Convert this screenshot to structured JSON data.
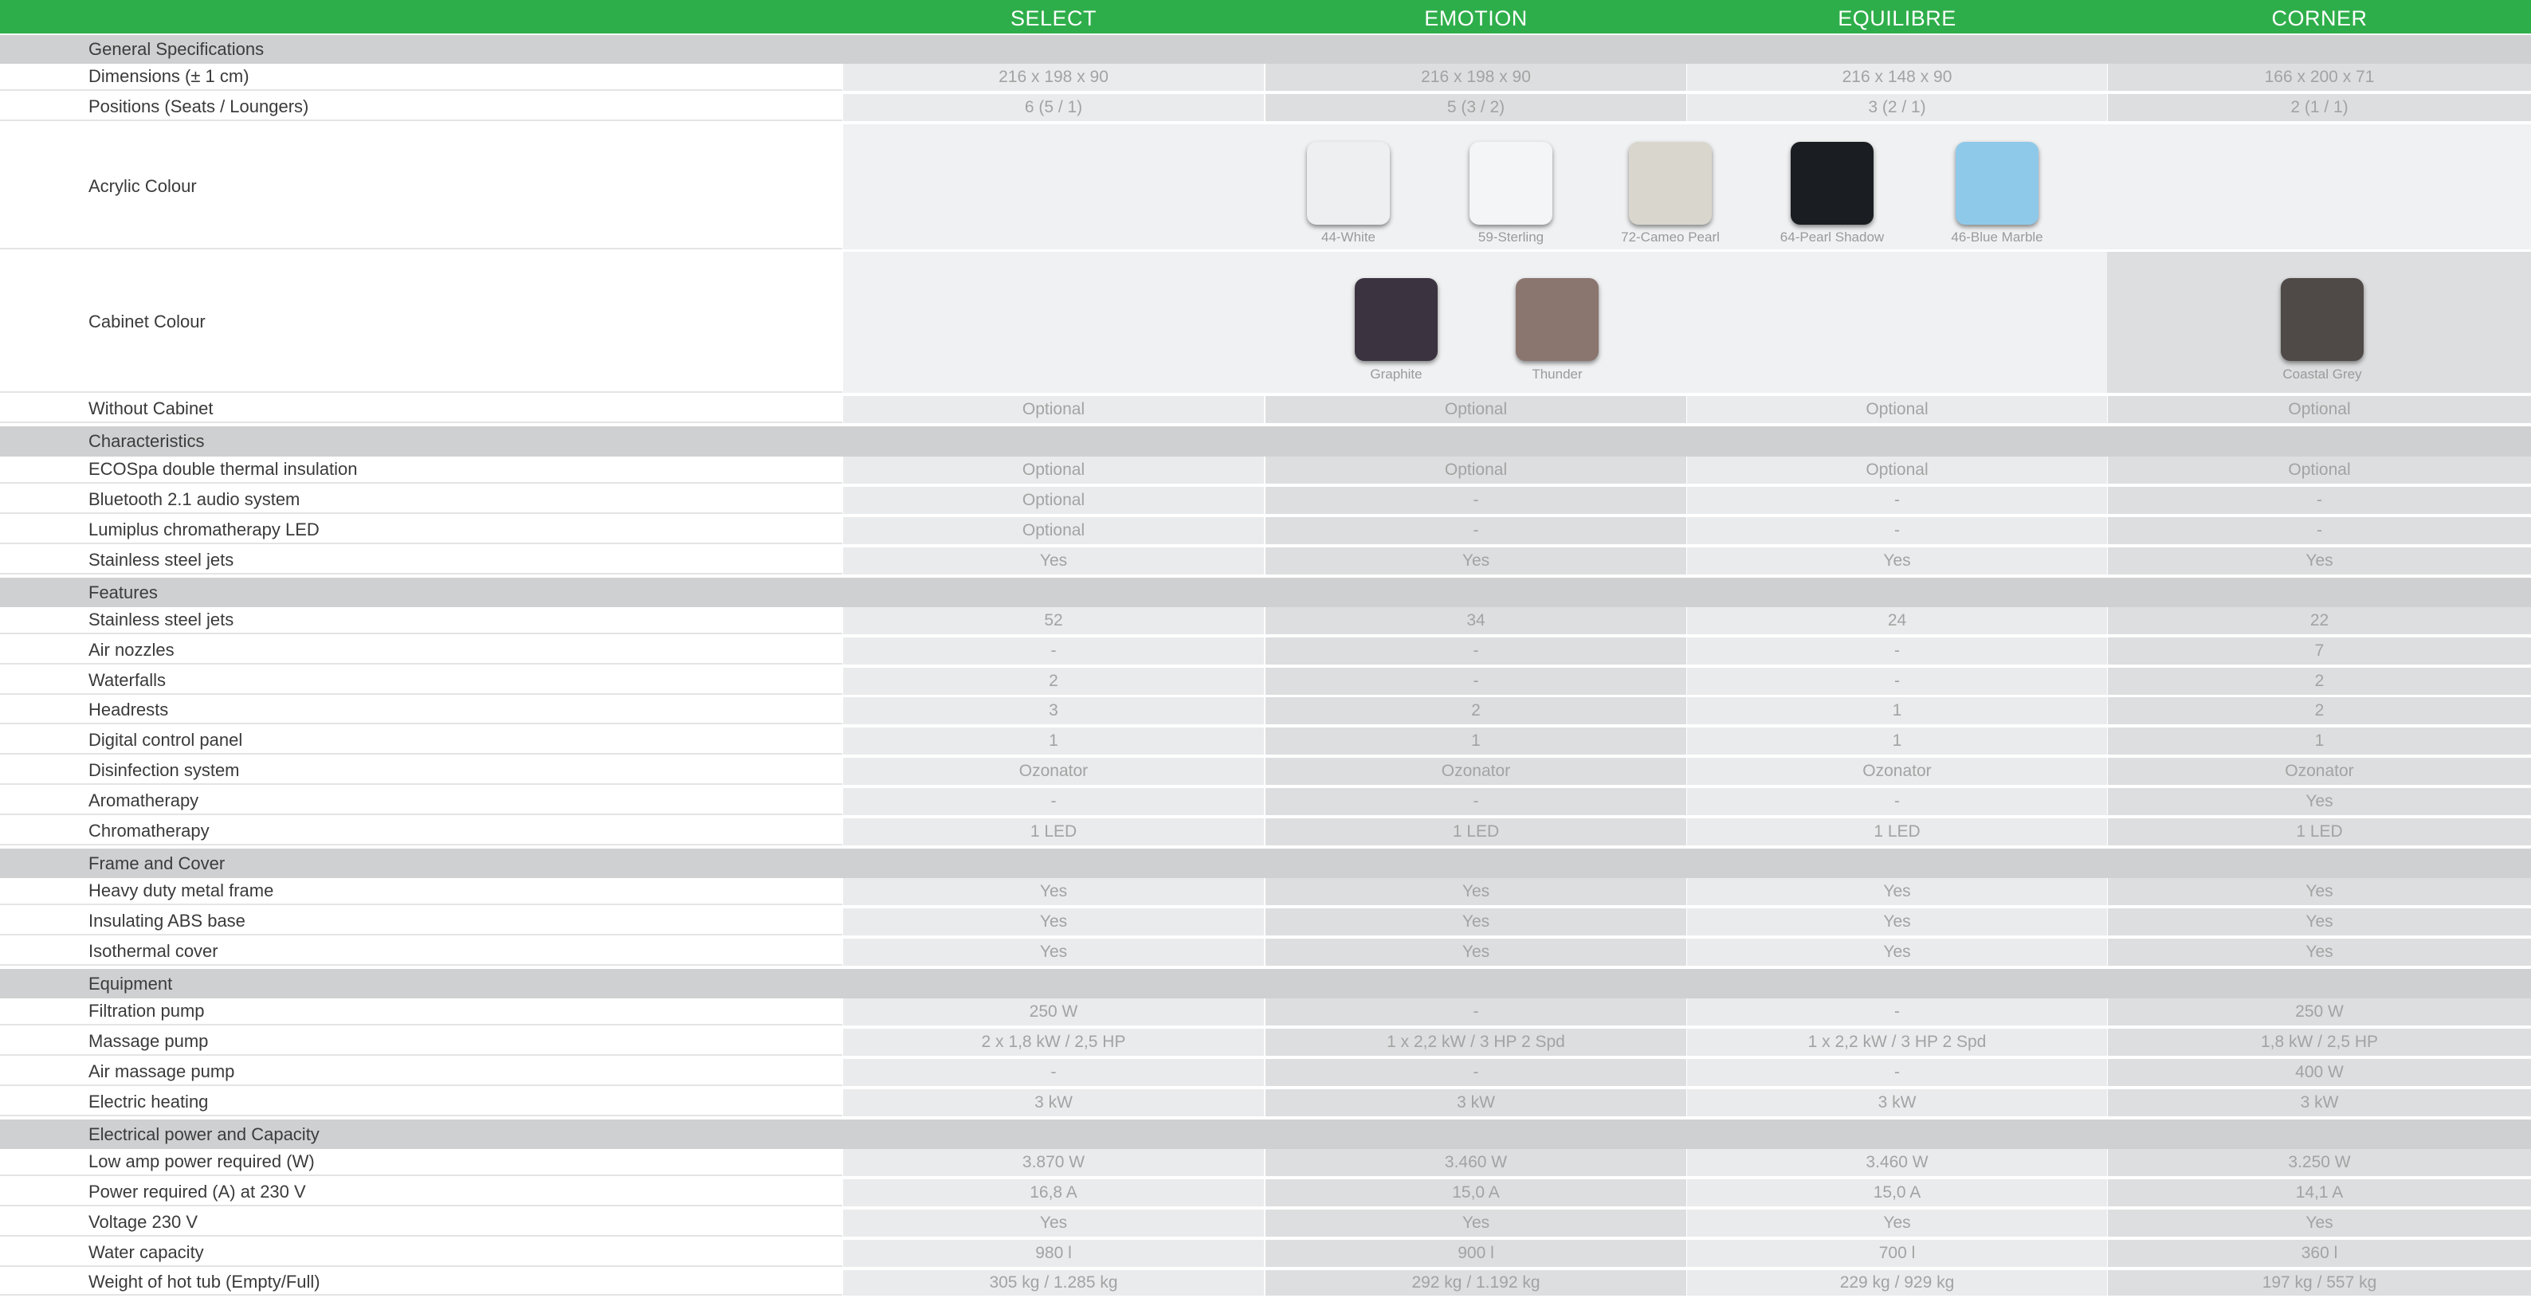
{
  "columns": [
    "SELECT",
    "EMOTION",
    "EQUILIBRE",
    "CORNER"
  ],
  "sections": {
    "general": "General Specifications",
    "characteristics": "Characteristics",
    "features": "Features",
    "frame": "Frame and Cover",
    "equipment": "Equipment",
    "electrical": "Electrical power and Capacity"
  },
  "rows": {
    "dimensions": {
      "label": "Dimensions (± 1 cm)",
      "values": [
        "216 x 198 x 90",
        "216 x 198 x 90",
        "216 x 148 x 90",
        "166 x 200 x 71"
      ]
    },
    "positions": {
      "label": "Positions (Seats / Loungers)",
      "values": [
        "6 (5 / 1)",
        "5 (3 / 2)",
        "3 (2 / 1)",
        "2 (1 / 1)"
      ]
    },
    "acrylic": {
      "label": "Acrylic Colour"
    },
    "cabinet": {
      "label": "Cabinet Colour"
    },
    "without_cabinet": {
      "label": "Without Cabinet",
      "values": [
        "Optional",
        "Optional",
        "Optional",
        "Optional"
      ]
    },
    "ecospa": {
      "label": "ECOSpa double thermal insulation",
      "values": [
        "Optional",
        "Optional",
        "Optional",
        "Optional"
      ]
    },
    "bluetooth": {
      "label": "Bluetooth 2.1 audio system",
      "values": [
        "Optional",
        "-",
        "-",
        "-"
      ]
    },
    "lumiplus": {
      "label": "Lumiplus chromatherapy LED",
      "values": [
        "Optional",
        "-",
        "-",
        "-"
      ]
    },
    "ss_jets_char": {
      "label": "Stainless steel jets",
      "values": [
        "Yes",
        "Yes",
        "Yes",
        "Yes"
      ]
    },
    "ss_jets": {
      "label": "Stainless steel jets",
      "values": [
        "52",
        "34",
        "24",
        "22"
      ]
    },
    "air_nozzles": {
      "label": "Air nozzles",
      "values": [
        "-",
        "-",
        "-",
        "7"
      ]
    },
    "waterfalls": {
      "label": "Waterfalls",
      "values": [
        "2",
        "-",
        "-",
        "2"
      ]
    },
    "headrests": {
      "label": "Headrests",
      "values": [
        "3",
        "2",
        "1",
        "2"
      ]
    },
    "control_panel": {
      "label": "Digital control panel",
      "values": [
        "1",
        "1",
        "1",
        "1"
      ]
    },
    "disinfection": {
      "label": "Disinfection system",
      "values": [
        "Ozonator",
        "Ozonator",
        "Ozonator",
        "Ozonator"
      ]
    },
    "aromatherapy": {
      "label": "Aromatherapy",
      "values": [
        "-",
        "-",
        "-",
        "Yes"
      ]
    },
    "chromatherapy": {
      "label": "Chromatherapy",
      "values": [
        "1 LED",
        "1 LED",
        "1 LED",
        "1 LED"
      ]
    },
    "metal_frame": {
      "label": "Heavy duty metal frame",
      "values": [
        "Yes",
        "Yes",
        "Yes",
        "Yes"
      ]
    },
    "abs_base": {
      "label": "Insulating ABS base",
      "values": [
        "Yes",
        "Yes",
        "Yes",
        "Yes"
      ]
    },
    "iso_cover": {
      "label": "Isothermal cover",
      "values": [
        "Yes",
        "Yes",
        "Yes",
        "Yes"
      ]
    },
    "filtration": {
      "label": "Filtration pump",
      "values": [
        "250 W",
        "-",
        "-",
        "250 W"
      ]
    },
    "massage_pump": {
      "label": "Massage pump",
      "values": [
        "2 x 1,8 kW / 2,5 HP",
        "1 x 2,2 kW / 3 HP 2 Spd",
        "1 x 2,2 kW / 3 HP 2 Spd",
        "1,8 kW / 2,5 HP"
      ]
    },
    "air_massage": {
      "label": "Air massage pump",
      "values": [
        "-",
        "-",
        "-",
        "400 W"
      ]
    },
    "heating": {
      "label": "Electric heating",
      "values": [
        "3 kW",
        "3 kW",
        "3 kW",
        "3 kW"
      ]
    },
    "low_amp": {
      "label": "Low amp power required (W)",
      "values": [
        "3.870 W",
        "3.460 W",
        "3.460 W",
        "3.250 W"
      ]
    },
    "power_a": {
      "label": "Power required (A) at 230 V",
      "values": [
        "16,8 A",
        "15,0 A",
        "15,0 A",
        "14,1 A"
      ]
    },
    "voltage": {
      "label": "Voltage 230 V",
      "values": [
        "Yes",
        "Yes",
        "Yes",
        "Yes"
      ]
    },
    "water": {
      "label": "Water capacity",
      "values": [
        "980 l",
        "900 l",
        "700 l",
        "360 l"
      ]
    },
    "weight": {
      "label": "Weight of hot tub (Empty/Full)",
      "values": [
        "305 kg / 1.285 kg",
        "292 kg / 1.192 kg",
        "229 kg / 929 kg",
        "197 kg / 557 kg"
      ]
    }
  },
  "acrylic_swatches": [
    {
      "name": "44-White",
      "color": "#eeeff1"
    },
    {
      "name": "59-Sterling",
      "color": "#f4f5f6"
    },
    {
      "name": "72-Cameo Pearl",
      "color": "#d9d6cd"
    },
    {
      "name": "64-Pearl Shadow",
      "color": "#1a1e22"
    },
    {
      "name": "46-Blue Marble",
      "color": "#8fc9ea"
    }
  ],
  "cabinet_swatches": [
    {
      "name": "Graphite",
      "color": "#3b3440"
    },
    {
      "name": "Thunder",
      "color": "#8b766f"
    },
    {
      "name": "Coastal Grey",
      "color": "#4f4a47"
    }
  ],
  "colors": {
    "header_green": "#2eae4a",
    "section_grey": "#cfd0d1"
  }
}
